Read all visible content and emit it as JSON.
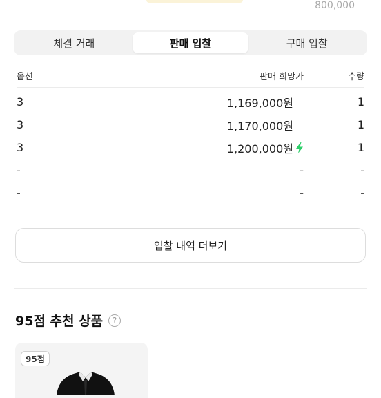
{
  "price_chart": {
    "top_value": "800,000"
  },
  "tabs": [
    {
      "label": "체결 거래",
      "active": false
    },
    {
      "label": "판매 입찰",
      "active": true
    },
    {
      "label": "구매 입찰",
      "active": false
    }
  ],
  "table": {
    "headers": {
      "option": "옵션",
      "price": "판매 희망가",
      "quantity": "수량"
    },
    "rows": [
      {
        "option": "3",
        "price": "1,169,000원",
        "quantity": "1",
        "fast_delivery": false
      },
      {
        "option": "3",
        "price": "1,170,000원",
        "quantity": "1",
        "fast_delivery": false
      },
      {
        "option": "3",
        "price": "1,200,000원",
        "quantity": "1",
        "fast_delivery": true
      },
      {
        "option": "-",
        "price": "-",
        "quantity": "-",
        "fast_delivery": false
      },
      {
        "option": "-",
        "price": "-",
        "quantity": "-",
        "fast_delivery": false
      }
    ]
  },
  "more_button": {
    "label": "입찰 내역 더보기"
  },
  "recommend": {
    "title": "95점 추천 상품",
    "help_icon": "question-circle-icon",
    "cards": [
      {
        "score": "95점"
      }
    ]
  },
  "colors": {
    "bolt": "#2ecf6a",
    "accent_bar": "#fbf3d8"
  }
}
